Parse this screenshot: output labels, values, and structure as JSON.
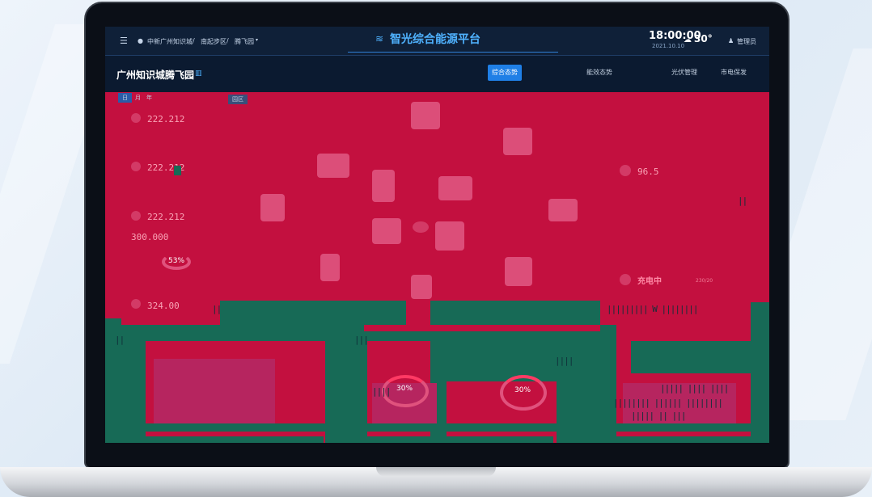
{
  "header": {
    "breadcrumb": [
      "中新广州知识城",
      "南起步区",
      "腾飞园"
    ],
    "app_title": "智光综合能源平台",
    "time": "18:00:00",
    "date": "2021.10.10",
    "temperature": "30°",
    "user": "管理员"
  },
  "subbar": {
    "park_name": "广州知识城腾飞园",
    "tabs": [
      {
        "label": "综合态势",
        "active": true
      },
      {
        "label": "能效态势",
        "active": false
      },
      {
        "label": "光伏管理",
        "active": false
      },
      {
        "label": "市电保发",
        "active": false
      }
    ],
    "period": [
      "日",
      "月",
      "年"
    ],
    "zone": "园区"
  },
  "left_panel": {
    "stats": [
      "222.212",
      "222.212",
      "222.212",
      "300.000",
      "324.00"
    ],
    "gauge": "53%"
  },
  "right_panel": {
    "value": "96.5",
    "status": "充电中",
    "status_detail": "230/20"
  },
  "bottom": {
    "gauge_a": "30%",
    "gauge_b": "30%"
  },
  "colors": {
    "accent": "#1f7fe6",
    "overlay": "#c3103f",
    "teal": "#176a56"
  }
}
